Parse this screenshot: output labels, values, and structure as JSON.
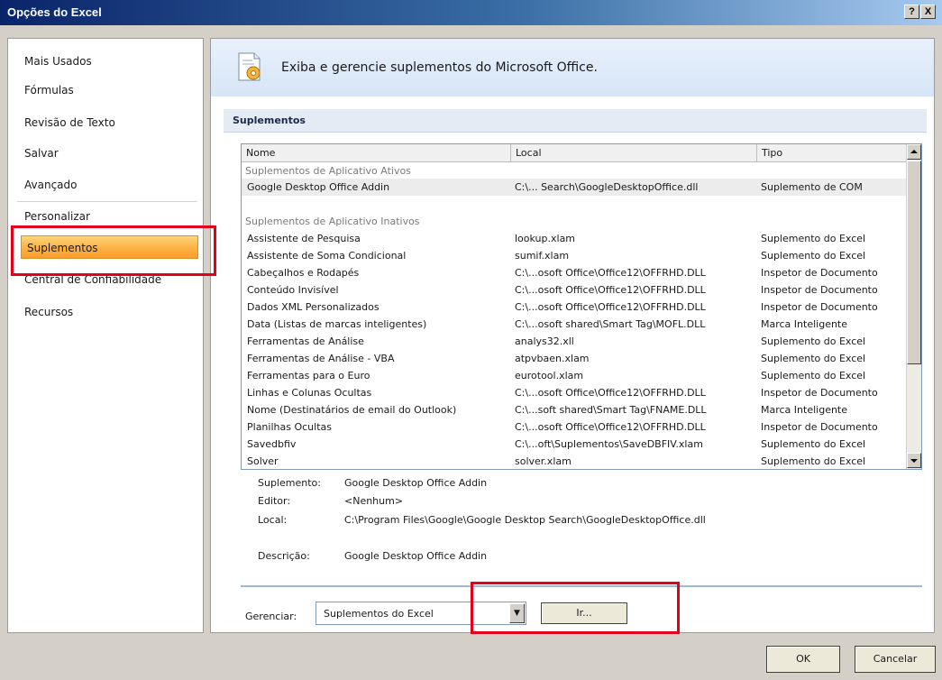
{
  "window": {
    "title": "Opções do Excel",
    "help_button": "?",
    "close_button": "X"
  },
  "sidebar": {
    "items": [
      {
        "label": "Mais Usados"
      },
      {
        "label": "Fórmulas"
      },
      {
        "label": "Revisão de Texto"
      },
      {
        "label": "Salvar"
      },
      {
        "label": "Avançado"
      },
      {
        "label": "Personalizar"
      },
      {
        "label": "Suplementos",
        "active": true
      },
      {
        "label": "Central de Confiabilidade"
      },
      {
        "label": "Recursos"
      }
    ]
  },
  "header": {
    "icon": "addins-gear-icon",
    "text": "Exiba e gerencie suplementos do Microsoft Office."
  },
  "section": {
    "title": "Suplementos"
  },
  "addins_table": {
    "columns": [
      "Nome",
      "Local",
      "Tipo"
    ],
    "groups": [
      {
        "title": "Suplementos de Aplicativo Ativos",
        "rows": [
          {
            "name": "Google Desktop Office Addin",
            "location": "C:\\... Search\\GoogleDesktopOffice.dll",
            "type": "Suplemento de COM",
            "selected": true
          }
        ]
      },
      {
        "title": "Suplementos de Aplicativo Inativos",
        "rows": [
          {
            "name": "Assistente de Pesquisa",
            "location": "lookup.xlam",
            "type": "Suplemento do Excel"
          },
          {
            "name": "Assistente de Soma Condicional",
            "location": "sumif.xlam",
            "type": "Suplemento do Excel"
          },
          {
            "name": "Cabeçalhos e Rodapés",
            "location": "C:\\...osoft Office\\Office12\\OFFRHD.DLL",
            "type": "Inspetor de Documento"
          },
          {
            "name": "Conteúdo Invisível",
            "location": "C:\\...osoft Office\\Office12\\OFFRHD.DLL",
            "type": "Inspetor de Documento"
          },
          {
            "name": "Dados XML Personalizados",
            "location": "C:\\...osoft Office\\Office12\\OFFRHD.DLL",
            "type": "Inspetor de Documento"
          },
          {
            "name": "Data (Listas de marcas inteligentes)",
            "location": "C:\\...osoft shared\\Smart Tag\\MOFL.DLL",
            "type": "Marca Inteligente"
          },
          {
            "name": "Ferramentas de Análise",
            "location": "analys32.xll",
            "type": "Suplemento do Excel"
          },
          {
            "name": "Ferramentas de Análise - VBA",
            "location": "atpvbaen.xlam",
            "type": "Suplemento do Excel"
          },
          {
            "name": "Ferramentas para o Euro",
            "location": "eurotool.xlam",
            "type": "Suplemento do Excel"
          },
          {
            "name": "Linhas e Colunas Ocultas",
            "location": "C:\\...osoft Office\\Office12\\OFFRHD.DLL",
            "type": "Inspetor de Documento"
          },
          {
            "name": "Nome (Destinatários de email do Outlook)",
            "location": "C:\\...soft shared\\Smart Tag\\FNAME.DLL",
            "type": "Marca Inteligente"
          },
          {
            "name": "Planilhas Ocultas",
            "location": "C:\\...osoft Office\\Office12\\OFFRHD.DLL",
            "type": "Inspetor de Documento"
          },
          {
            "name": "Savedbfiv",
            "location": "C:\\...oft\\Suplementos\\SaveDBFIV.xlam",
            "type": "Suplemento do Excel"
          },
          {
            "name": "Solver",
            "location": "solver.xlam",
            "type": "Suplemento do Excel"
          }
        ]
      }
    ]
  },
  "details": {
    "addin_label": "Suplemento:",
    "addin_value": "Google Desktop Office Addin",
    "publisher_label": "Editor:",
    "publisher_value": "<Nenhum>",
    "location_label": "Local:",
    "location_value": "C:\\Program Files\\Google\\Google Desktop Search\\GoogleDesktopOffice.dll",
    "description_label": "Descrição:",
    "description_value": "Google Desktop Office Addin"
  },
  "manage": {
    "label": "Gerenciar:",
    "selected": "Suplementos do Excel",
    "go_button": "Ir..."
  },
  "footer": {
    "ok_label": "OK",
    "cancel_label": "Cancelar"
  },
  "colors": {
    "highlight_box": "#e2001a",
    "active_item": "#fdb448",
    "title_bar": "#0a246a"
  }
}
